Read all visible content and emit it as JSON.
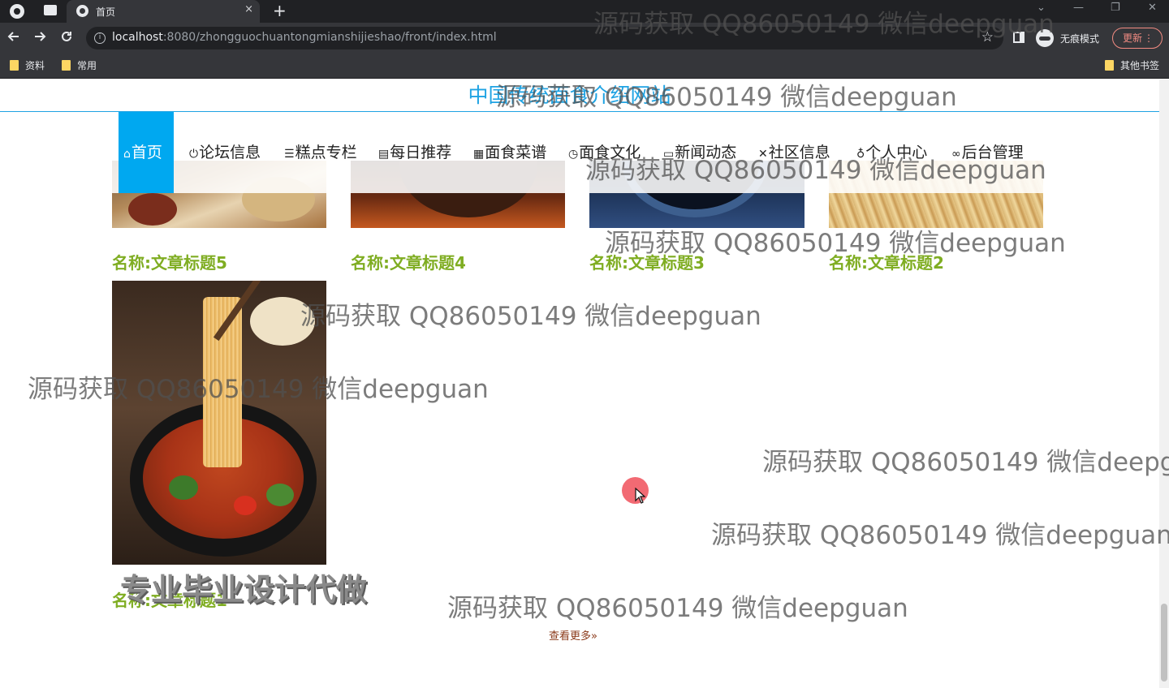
{
  "browser": {
    "tab_title": "首页",
    "tab_close": "×",
    "new_tab": "+",
    "url_host": "localhost",
    "url_path": ":8080/zhongguochuantongmianshijieshao/front/index.html",
    "info_icon": "i",
    "star": "☆",
    "incognito_label": "无痕模式",
    "update_label": "更新",
    "update_menu": "⋮",
    "win_minimize": "—",
    "win_restore": "❐",
    "win_close": "✕",
    "win_dropdown": "⌄",
    "bookmarks": [
      "资料",
      "常用"
    ],
    "other_bookmarks": "其他书签"
  },
  "site": {
    "title": "中国传统面食介绍网站"
  },
  "nav": {
    "items": [
      {
        "icon": "⌂",
        "label": "首页"
      },
      {
        "icon": "⏻",
        "label": "论坛信息"
      },
      {
        "icon": "☰",
        "label": "糕点专栏"
      },
      {
        "icon": "▤",
        "label": "每日推荐"
      },
      {
        "icon": "▦",
        "label": "面食菜谱"
      },
      {
        "icon": "◷",
        "label": "面食文化"
      },
      {
        "icon": "▭",
        "label": "新闻动态"
      },
      {
        "icon": "✕",
        "label": "社区信息"
      },
      {
        "icon": "♁",
        "label": "个人中心"
      },
      {
        "icon": "∞",
        "label": "后台管理"
      }
    ]
  },
  "articles": [
    {
      "title": "名称:文章标题5"
    },
    {
      "title": "名称:文章标题4"
    },
    {
      "title": "名称:文章标题3"
    },
    {
      "title": "名称:文章标题2"
    },
    {
      "title": "名称:文章标题1"
    }
  ],
  "promo_text": "专业毕业设计代做",
  "more_link": "查看更多»",
  "watermark": "源码获取 QQ86050149 微信deepguan",
  "colors": {
    "accent": "#00a8f0",
    "title_blue": "#1fa3e3",
    "article_title": "#7fad22",
    "more_link": "#8b3a1a"
  }
}
